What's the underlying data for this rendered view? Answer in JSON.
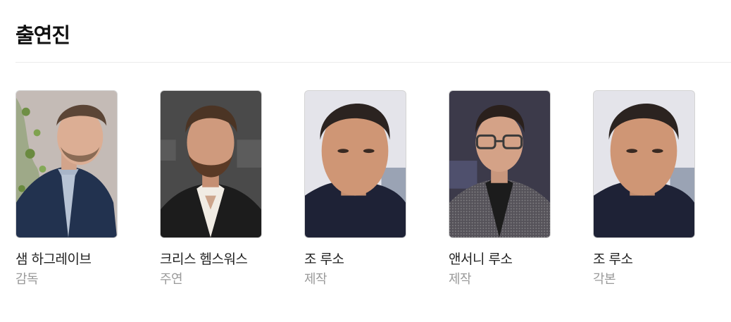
{
  "section": {
    "title": "출연진"
  },
  "cast": [
    {
      "name": "샘 하그레이브",
      "role": "감독",
      "photo": "portrait-man-navy-suit-light-background"
    },
    {
      "name": "크리스 헴스워스",
      "role": "주연",
      "photo": "portrait-man-beard-black-jacket-dark-background"
    },
    {
      "name": "조 루소",
      "role": "제작",
      "photo": "portrait-man-closeup-dark-shirt"
    },
    {
      "name": "앤서니 루소",
      "role": "제작",
      "photo": "portrait-man-glasses-patterned-jacket"
    },
    {
      "name": "조 루소",
      "role": "각본",
      "photo": "portrait-man-closeup-dark-shirt"
    }
  ],
  "colors": {
    "title": "#111111",
    "name": "#222222",
    "role": "#9a9a9a",
    "divider": "#ebebeb"
  }
}
